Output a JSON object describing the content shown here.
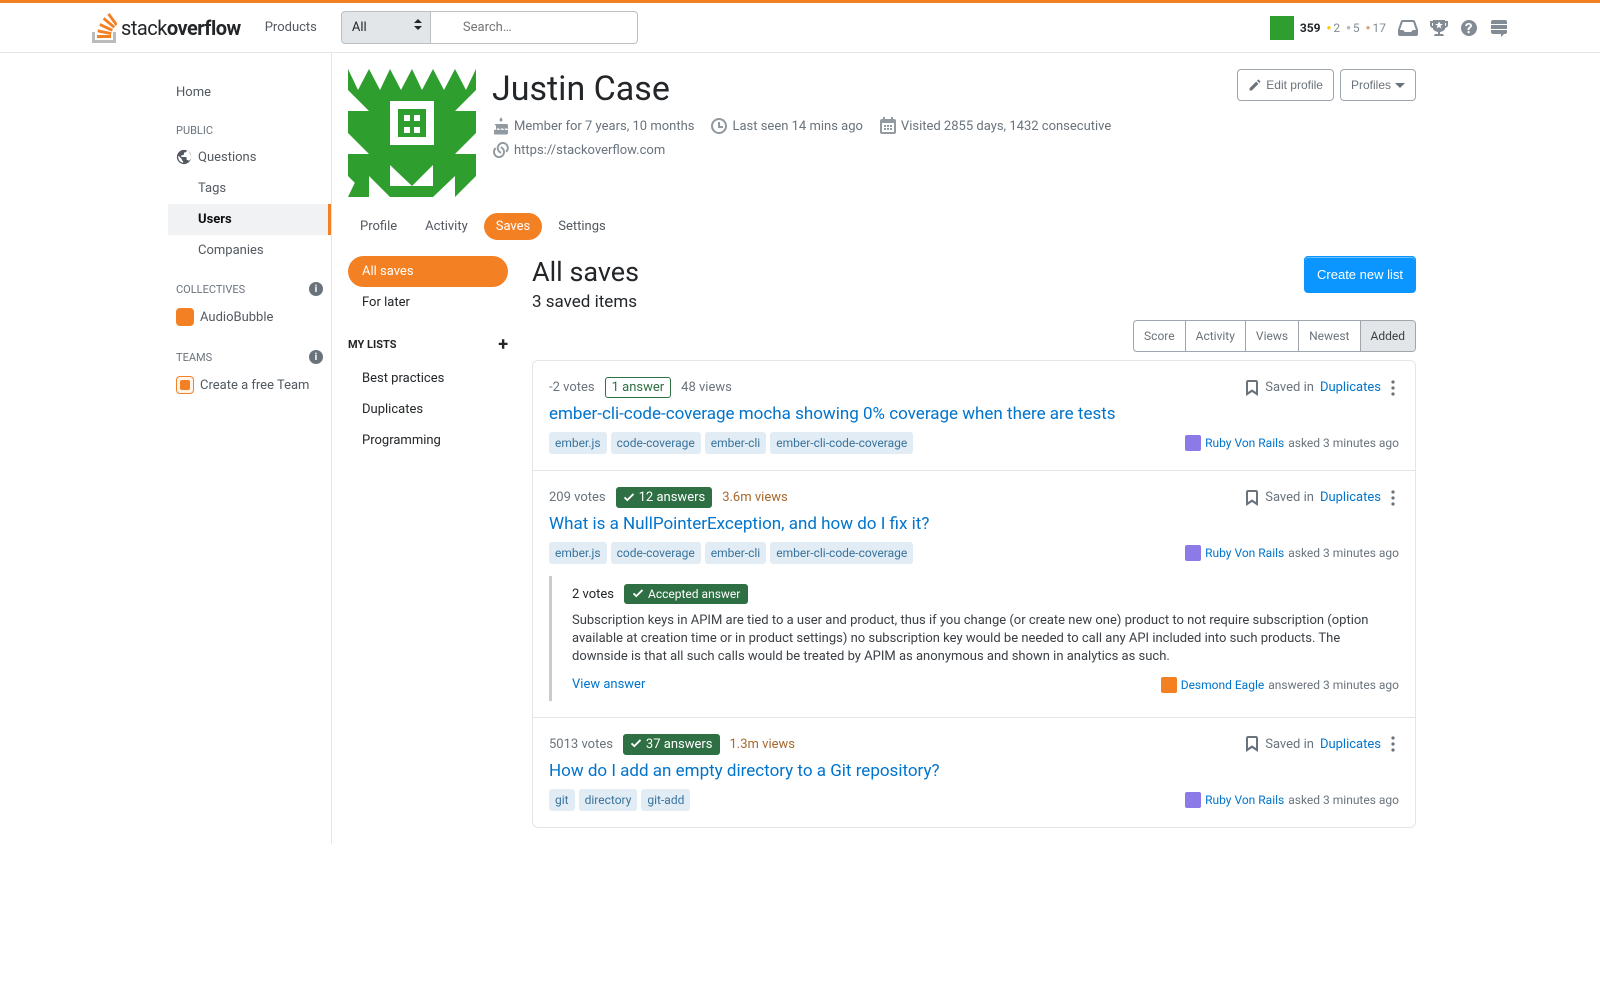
{
  "header": {
    "products": "Products",
    "search_scope": "All",
    "search_placeholder": "Search…",
    "rep": "359",
    "gold": "2",
    "silver": "5",
    "bronze": "17"
  },
  "sidebar": {
    "home": "Home",
    "public": "PUBLIC",
    "questions": "Questions",
    "tags": "Tags",
    "users": "Users",
    "companies": "Companies",
    "collectives": "COLLECTIVES",
    "audiobubble": "AudioBubble",
    "teams": "TEAMS",
    "create_team": "Create a free Team"
  },
  "profile": {
    "name": "Justin Case",
    "member_for": "Member for 7 years, 10 months",
    "last_seen": "Last seen 14 mins ago",
    "visited": "Visited 2855 days, 1432 consecutive",
    "url": "https://stackoverflow.com",
    "edit": "Edit profile",
    "profiles": "Profiles"
  },
  "tabs": {
    "profile": "Profile",
    "activity": "Activity",
    "saves": "Saves",
    "settings": "Settings"
  },
  "lists": {
    "all_saves": "All saves",
    "for_later": "For later",
    "my_lists": "MY LISTS",
    "best_practices": "Best practices",
    "duplicates": "Duplicates",
    "programming": "Programming"
  },
  "main": {
    "title": "All saves",
    "count": "3 saved items",
    "create": "Create new list",
    "saved_in": "Saved in",
    "sort": {
      "score": "Score",
      "activity": "Activity",
      "views": "Views",
      "newest": "Newest",
      "added": "Added"
    }
  },
  "items": [
    {
      "votes": "-2 votes",
      "answers": "1 answer",
      "answers_accepted": false,
      "views": "48 views",
      "views_hot": false,
      "title": "ember-cli-code-coverage mocha showing 0% coverage when there are tests",
      "tags": [
        "ember.js",
        "code-coverage",
        "ember-cli",
        "ember-cli-code-coverage"
      ],
      "saved_list": "Duplicates",
      "author": "Ruby Von Rails",
      "action": "asked 3 minutes ago"
    },
    {
      "votes": "209 votes",
      "answers": "12 answers",
      "answers_accepted": true,
      "views": "3.6m views",
      "views_hot": true,
      "title": "What is a NullPointerException, and how do I fix it?",
      "tags": [
        "ember.js",
        "code-coverage",
        "ember-cli",
        "ember-cli-code-coverage"
      ],
      "saved_list": "Duplicates",
      "author": "Ruby Von Rails",
      "action": "asked 3 minutes ago",
      "answer": {
        "votes": "2 votes",
        "badge": "Accepted answer",
        "body": "Subscription keys in APIM are tied to a user and product, thus if you change (or create new one) product to not require subscription (option available at creation time or in product settings) no subscription key would be needed to call any API included into such products. The downside is that all such calls would be treated by APIM as anonymous and shown in analytics as such.",
        "view": "View answer",
        "author": "Desmond Eagle",
        "action": "answered 3 minutes ago"
      }
    },
    {
      "votes": "5013 votes",
      "answers": "37 answers",
      "answers_accepted": true,
      "views": "1.3m views",
      "views_hot": true,
      "title": "How do I add an empty directory to a Git repository?",
      "tags": [
        "git",
        "directory",
        "git-add"
      ],
      "saved_list": "Duplicates",
      "author": "Ruby Von Rails",
      "action": "asked 3 minutes ago"
    }
  ]
}
